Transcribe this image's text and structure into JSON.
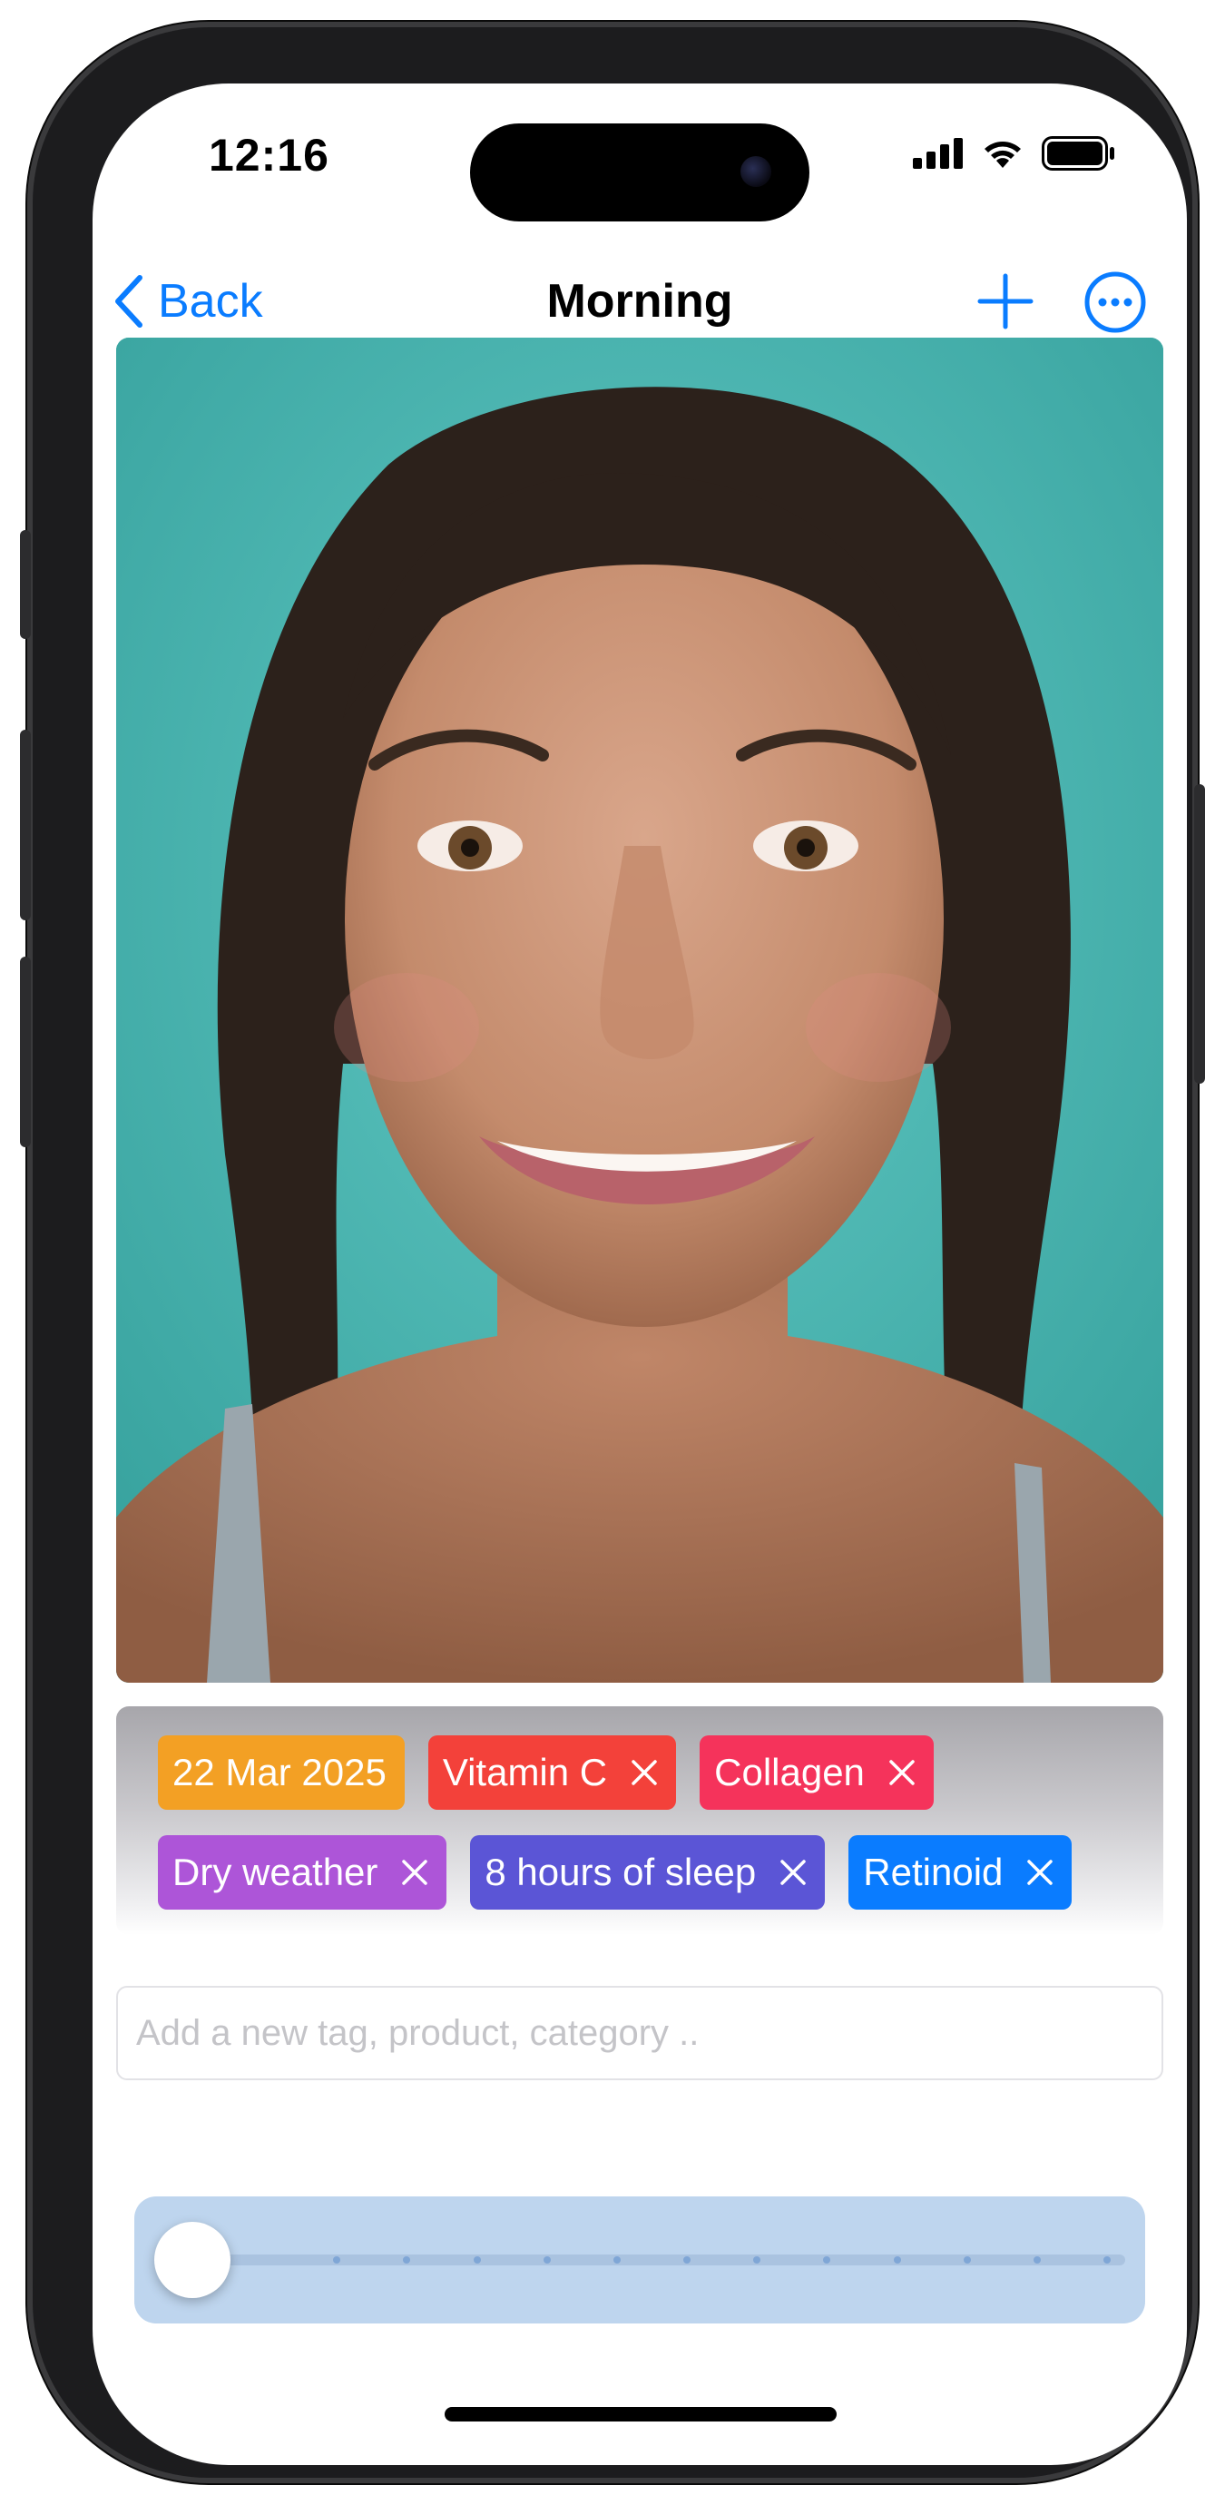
{
  "status_bar": {
    "time": "12:16",
    "icons": [
      "cellular-signal-icon",
      "wifi-icon",
      "battery-icon"
    ]
  },
  "nav": {
    "back_label": "Back",
    "title": "Morning",
    "actions": [
      "add-icon",
      "more-options-icon"
    ]
  },
  "photo": {
    "kind": "portrait-photo",
    "background_color": "#4cb8b4"
  },
  "tags": [
    {
      "label": "22 Mar 2025",
      "color": "#f3a024",
      "removable": false
    },
    {
      "label": "Vitamin C",
      "color": "#f3413a",
      "removable": true
    },
    {
      "label": "Collagen",
      "color": "#f5335b",
      "removable": true
    },
    {
      "label": "Dry weather",
      "color": "#ad55d8",
      "removable": true
    },
    {
      "label": "8 hours of sleep",
      "color": "#5b55d6",
      "removable": true
    },
    {
      "label": "Retinoid",
      "color": "#0a7cff",
      "removable": true
    }
  ],
  "tag_input": {
    "value": "",
    "placeholder": "Add a new tag, product, category .."
  },
  "timeline_slider": {
    "stops": 13,
    "selected_index": 0
  },
  "colors": {
    "accent": "#0a7cff",
    "slider_panel": "#bed5ee"
  }
}
